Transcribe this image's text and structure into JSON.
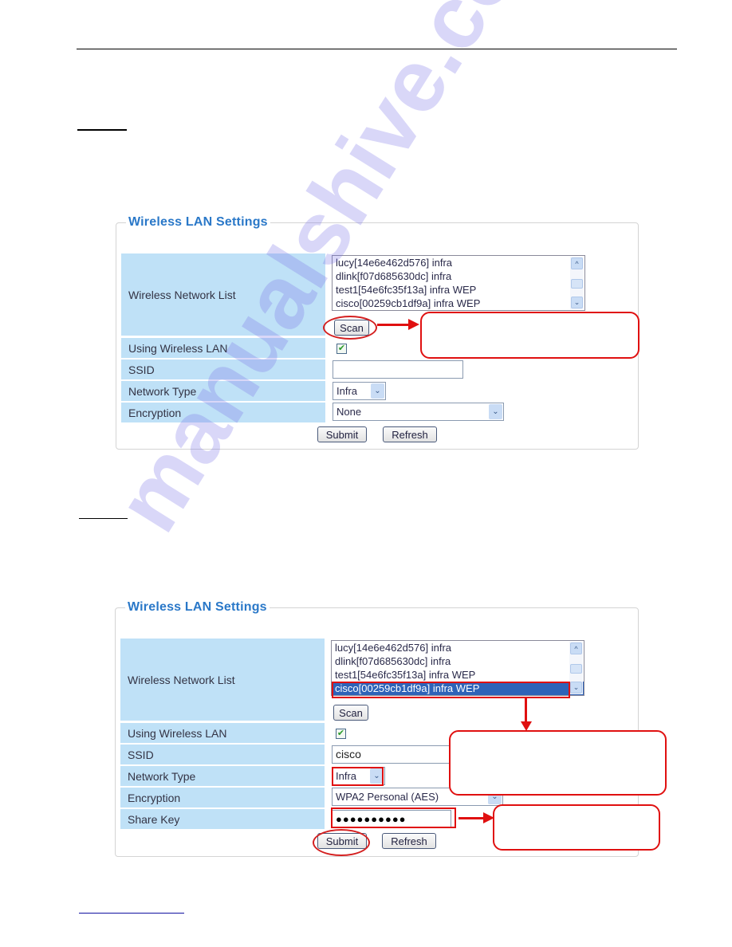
{
  "watermark": "manualshive.com",
  "panels": [
    {
      "title": "Wireless LAN Settings",
      "labels": {
        "network_list": "Wireless Network List",
        "using_wlan": "Using Wireless LAN",
        "ssid": "SSID",
        "network_type": "Network Type",
        "encryption": "Encryption"
      },
      "networks": [
        "lucy[14e6e462d576] infra",
        "dlink[f07d685630dc] infra",
        "test1[54e6fc35f13a] infra WEP",
        "cisco[00259cb1df9a] infra WEP"
      ],
      "selected_network_index": null,
      "scan_label": "Scan",
      "using_wlan_checked": true,
      "ssid_value": "",
      "network_type_value": "Infra",
      "encryption_value": "None",
      "submit_label": "Submit",
      "refresh_label": "Refresh"
    },
    {
      "title": "Wireless LAN Settings",
      "labels": {
        "network_list": "Wireless Network List",
        "using_wlan": "Using Wireless LAN",
        "ssid": "SSID",
        "network_type": "Network Type",
        "encryption": "Encryption",
        "share_key": "Share Key"
      },
      "networks": [
        "lucy[14e6e462d576] infra",
        "dlink[f07d685630dc] infra",
        "test1[54e6fc35f13a] infra WEP",
        "cisco[00259cb1df9a] infra WEP"
      ],
      "selected_network_index": 3,
      "scan_label": "Scan",
      "using_wlan_checked": true,
      "ssid_value": "cisco",
      "network_type_value": "Infra",
      "encryption_value": "WPA2 Personal (AES)",
      "share_key_masked": "●●●●●●●●●●",
      "submit_label": "Submit",
      "refresh_label": "Refresh"
    }
  ],
  "icons": {
    "check": "✔",
    "chevron_down": "⌄",
    "chevron_up": "^",
    "select_arrow": "▾"
  },
  "colors": {
    "title_blue": "#2a78c8",
    "label_bg": "#bfe1f7",
    "annotation_red": "#e01010",
    "selection_blue": "#2e63b8"
  }
}
